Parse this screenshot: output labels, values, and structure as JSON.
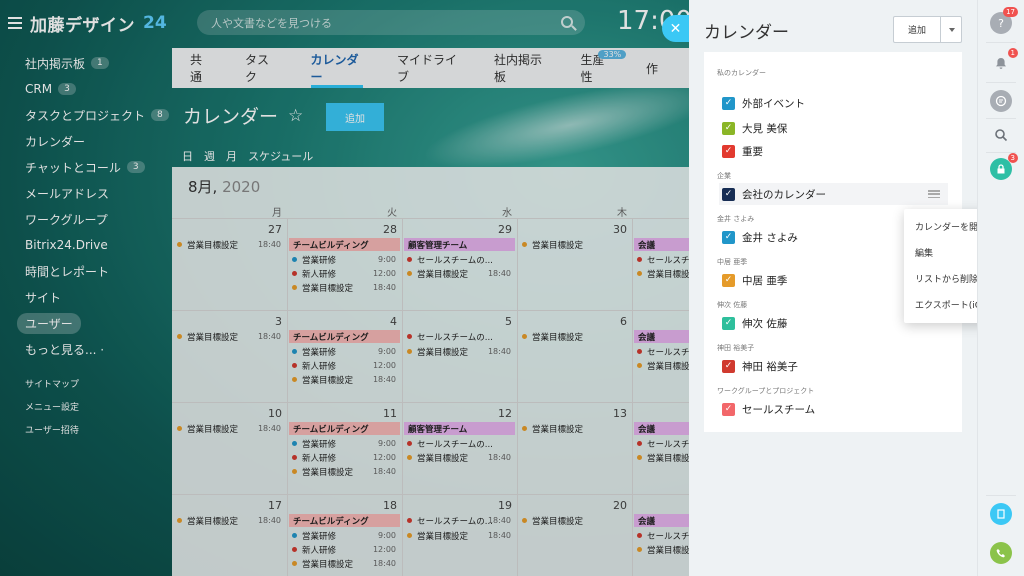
{
  "app": {
    "name": "加藤デザイン",
    "version": "24"
  },
  "search": {
    "placeholder": "人や文書などを見つける"
  },
  "clock": "17:00",
  "left_menu": {
    "items": [
      {
        "label": "社内掲示板",
        "count": "1"
      },
      {
        "label": "CRM",
        "count": "3"
      },
      {
        "label": "タスクとプロジェクト",
        "count": "8"
      },
      {
        "label": "カレンダー",
        "count": ""
      },
      {
        "label": "チャットとコール",
        "count": "3"
      },
      {
        "label": "メールアドレス",
        "count": ""
      },
      {
        "label": "ワークグループ",
        "count": ""
      },
      {
        "label": "Bitrix24.Drive",
        "count": ""
      },
      {
        "label": "時間とレポート",
        "count": ""
      },
      {
        "label": "サイト",
        "count": ""
      },
      {
        "label": "ユーザー",
        "count": ""
      },
      {
        "label": "もっと見る... ·",
        "count": ""
      }
    ],
    "small": [
      "サイトマップ",
      "メニュー設定",
      "ユーザー招待"
    ]
  },
  "tabs": [
    {
      "label": "共通"
    },
    {
      "label": "タスク"
    },
    {
      "label": "カレンダー"
    },
    {
      "label": "マイドライブ"
    },
    {
      "label": "社内掲示板"
    },
    {
      "label": "生産性",
      "badge": "33%"
    },
    {
      "label": "作"
    }
  ],
  "page": {
    "title": "カレンダー",
    "add_label": "追加",
    "view_tabs": [
      "日",
      "週",
      "月",
      "スケジュール"
    ]
  },
  "calendar": {
    "month": "8月,",
    "year": "2020",
    "dows": [
      "月",
      "火",
      "水",
      "木"
    ],
    "weeks": [
      {
        "days": [
          "27",
          "28",
          "29",
          "30"
        ]
      },
      {
        "days": [
          "3",
          "4",
          "5",
          "6"
        ]
      },
      {
        "days": [
          "10",
          "11",
          "12",
          "13"
        ]
      },
      {
        "days": [
          "17",
          "18",
          "19",
          "20"
        ]
      }
    ],
    "events": {
      "sales_goal": "営業目標設定",
      "sales_goal_time": "18:40",
      "team_building": "チームビルディング",
      "sales_training": "営業研修",
      "sales_training_time": "9:00",
      "new_training": "新人研修",
      "new_training_time": "12:00",
      "cust_team": "顧客管理チーム",
      "sales_team": "セールスチームの...",
      "sales_team_time": "18:40",
      "meeting": "会議",
      "sales_team_short": "セールスチ"
    }
  },
  "panel": {
    "title": "カレンダー",
    "add_label": "追加",
    "sections": {
      "mine": "私のカレンダー",
      "company": "企業",
      "kanai": "金井 さよみ",
      "nakai": "中居 亜季",
      "shinji": "伸次 佐藤",
      "kanda": "神田 裕美子",
      "workgroups": "ワークグループとプロジェクト"
    },
    "items": {
      "external": "外部イベント",
      "omi": "大見 美保",
      "important": "重要",
      "company_cal": "会社のカレンダー",
      "kanai": "金井 さよみ",
      "nakai": "中居 亜季",
      "shinji": "伸次 佐藤",
      "kanda": "神田 裕美子",
      "sales": "セールスチーム"
    },
    "colors": {
      "external": "#2196c9",
      "omi": "#8bb627",
      "important": "#e23a2f",
      "company_cal": "#172d54",
      "kanai": "#2196c9",
      "nakai": "#e59b2a",
      "shinji": "#2ebf9c",
      "kanda": "#d03a2f",
      "sales": "#f2676a"
    }
  },
  "context_menu": [
    "カレンダーを開く",
    "編集",
    "リストから削除する",
    "エクスポート(iCal)"
  ],
  "right_bar": {
    "help_badge": "17",
    "bell_badge": "1",
    "lock_badge": "3"
  }
}
